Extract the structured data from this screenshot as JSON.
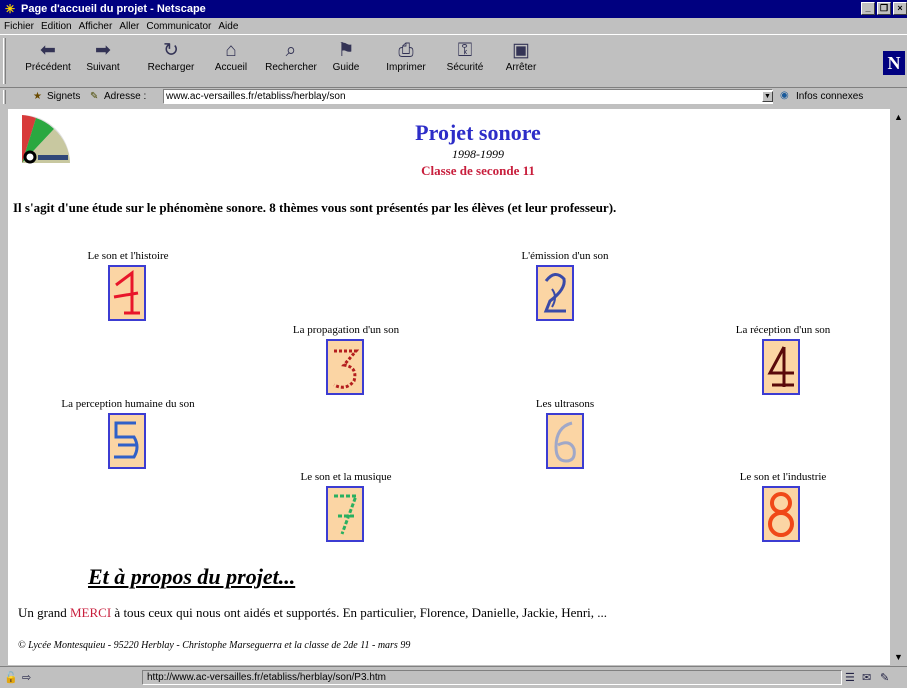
{
  "window": {
    "title": "Page d'accueil du projet - Netscape",
    "controls": [
      "_",
      "❐",
      "×"
    ]
  },
  "menu": [
    "Fichier",
    "Edition",
    "Afficher",
    "Aller",
    "Communicator",
    "Aide"
  ],
  "toolbar": [
    {
      "label": "Précédent",
      "icon": "back-arrow-icon",
      "glyph": "⬅"
    },
    {
      "label": "Suivant",
      "icon": "forward-arrow-icon",
      "glyph": "➡"
    },
    {
      "label": "Recharger",
      "icon": "reload-icon",
      "glyph": "↻"
    },
    {
      "label": "Accueil",
      "icon": "home-icon",
      "glyph": "⌂"
    },
    {
      "label": "Rechercher",
      "icon": "search-icon",
      "glyph": "⌕"
    },
    {
      "label": "Guide",
      "icon": "guide-icon",
      "glyph": "⚑"
    },
    {
      "label": "Imprimer",
      "icon": "print-icon",
      "glyph": "⎙"
    },
    {
      "label": "Sécurité",
      "icon": "lock-icon",
      "glyph": "⚿"
    },
    {
      "label": "Arrêter",
      "icon": "stop-icon",
      "glyph": "▣"
    }
  ],
  "brand_letter": "N",
  "location": {
    "bookmarks_label": "Signets",
    "address_label": "Adresse :",
    "url": "www.ac-versailles.fr/etabliss/herblay/son",
    "related_label": "Infos connexes"
  },
  "page": {
    "title": "Projet sonore",
    "year": "1998-1999",
    "class_label": "Classe de seconde 11",
    "intro": "Il s'agit d'une étude sur le phénomène sonore. 8 thèmes vous sont présentés par les élèves (et leur professeur).",
    "themes": [
      {
        "label": "Le son et l'histoire",
        "number": "1",
        "color": "#e8162a"
      },
      {
        "label": "L'émission d'un son",
        "number": "2",
        "color": "#3a4aa8"
      },
      {
        "label": "La propagation d'un son",
        "number": "3",
        "color": "#b41e1e"
      },
      {
        "label": "La réception d'un son",
        "number": "4",
        "color": "#5a0a0a"
      },
      {
        "label": "La perception humaine du son",
        "number": "5",
        "color": "#3060c8"
      },
      {
        "label": "Les ultrasons",
        "number": "6",
        "color": "#a0a8c8"
      },
      {
        "label": "Le son et la musique",
        "number": "7",
        "color": "#28b060"
      },
      {
        "label": "Le son et l'industrie",
        "number": "8",
        "color": "#f04818"
      }
    ],
    "about_link": "Et à propos du projet...",
    "merci_prefix": "Un grand ",
    "merci_word": "MERCI",
    "merci_suffix": " à tous ceux qui nous ont aidés et supportés. En particulier, Florence, Danielle, Jackie, Henri, ...",
    "footer": "© Lycée Montesquieu - 95220 Herblay - Christophe  Marseguerra et la classe de 2de 11 - mars 99"
  },
  "status": {
    "url": "http://www.ac-versailles.fr/etabliss/herblay/son/P3.htm"
  }
}
